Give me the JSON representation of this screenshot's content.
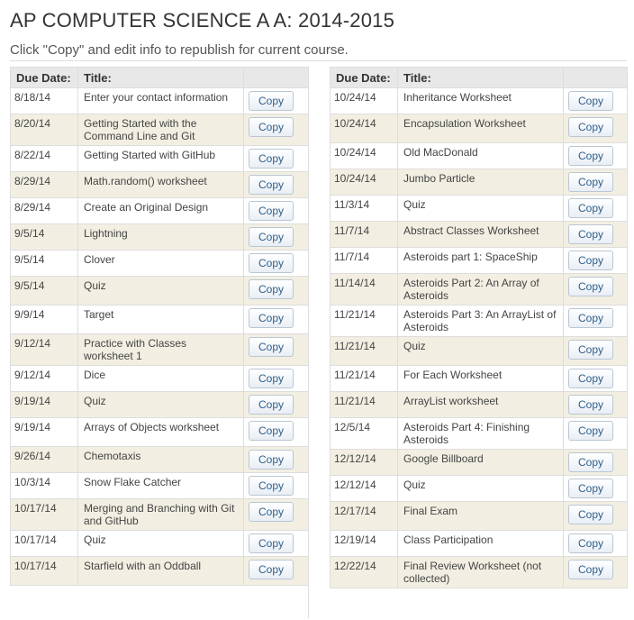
{
  "page": {
    "title": "AP COMPUTER SCIENCE A A: 2014-2015",
    "subtitle": "Click \"Copy\" and edit info to republish for current course."
  },
  "table": {
    "headers": {
      "due_date": "Due Date:",
      "title": "Title:"
    },
    "copy_label": "Copy",
    "left": [
      {
        "date": "8/18/14",
        "title": "Enter your contact information"
      },
      {
        "date": "8/20/14",
        "title": "Getting Started with the Command Line and Git"
      },
      {
        "date": "8/22/14",
        "title": "Getting Started with GitHub"
      },
      {
        "date": "8/29/14",
        "title": "Math.random() worksheet"
      },
      {
        "date": "8/29/14",
        "title": "Create an Original Design"
      },
      {
        "date": "9/5/14",
        "title": "Lightning"
      },
      {
        "date": "9/5/14",
        "title": "Clover"
      },
      {
        "date": "9/5/14",
        "title": "Quiz"
      },
      {
        "date": "9/9/14",
        "title": "Target"
      },
      {
        "date": "9/12/14",
        "title": "Practice with Classes worksheet 1"
      },
      {
        "date": "9/12/14",
        "title": "Dice"
      },
      {
        "date": "9/19/14",
        "title": "Quiz"
      },
      {
        "date": "9/19/14",
        "title": "Arrays of Objects worksheet"
      },
      {
        "date": "9/26/14",
        "title": "Chemotaxis"
      },
      {
        "date": "10/3/14",
        "title": "Snow Flake Catcher"
      },
      {
        "date": "10/17/14",
        "title": "Merging and Branching with Git and GitHub"
      },
      {
        "date": "10/17/14",
        "title": "Quiz"
      },
      {
        "date": "10/17/14",
        "title": "Starfield with an Oddball"
      }
    ],
    "right": [
      {
        "date": "10/24/14",
        "title": "Inheritance Worksheet"
      },
      {
        "date": "10/24/14",
        "title": "Encapsulation Worksheet"
      },
      {
        "date": "10/24/14",
        "title": "Old MacDonald"
      },
      {
        "date": "10/24/14",
        "title": "Jumbo Particle"
      },
      {
        "date": "11/3/14",
        "title": "Quiz"
      },
      {
        "date": "11/7/14",
        "title": "Abstract Classes Worksheet"
      },
      {
        "date": "11/7/14",
        "title": "Asteroids part 1: SpaceShip"
      },
      {
        "date": "11/14/14",
        "title": "Asteroids Part 2: An Array of Asteroids"
      },
      {
        "date": "11/21/14",
        "title": "Asteroids Part 3: An ArrayList of Asteroids"
      },
      {
        "date": "11/21/14",
        "title": "Quiz"
      },
      {
        "date": "11/21/14",
        "title": "For Each Worksheet"
      },
      {
        "date": "11/21/14",
        "title": "ArrayList worksheet"
      },
      {
        "date": "12/5/14",
        "title": "Asteroids Part 4: Finishing Asteroids"
      },
      {
        "date": "12/12/14",
        "title": "Google Billboard"
      },
      {
        "date": "12/12/14",
        "title": "Quiz"
      },
      {
        "date": "12/17/14",
        "title": "Final Exam"
      },
      {
        "date": "12/19/14",
        "title": "Class Participation"
      },
      {
        "date": "12/22/14",
        "title": "Final Review Worksheet (not collected)"
      }
    ]
  }
}
